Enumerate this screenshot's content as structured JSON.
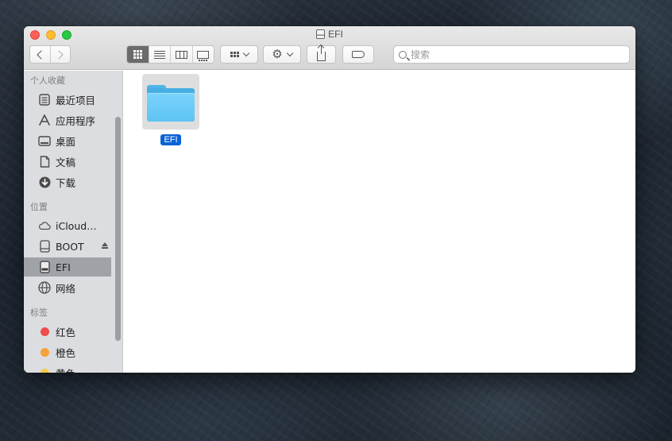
{
  "window": {
    "title": "EFI",
    "title_icon": "drive-icon"
  },
  "toolbar": {
    "back_icon": "chevron-left-icon",
    "forward_icon": "chevron-right-icon",
    "views": [
      "icon-view",
      "list-view",
      "column-view",
      "gallery-view"
    ],
    "active_view": "icon-view",
    "search": {
      "placeholder": "搜索",
      "value": ""
    }
  },
  "sidebar": {
    "sections": [
      {
        "title": "个人收藏",
        "items": [
          {
            "label": "最近项目",
            "icon": "recents-icon"
          },
          {
            "label": "应用程序",
            "icon": "applications-icon"
          },
          {
            "label": "桌面",
            "icon": "desktop-icon"
          },
          {
            "label": "文稿",
            "icon": "documents-icon"
          },
          {
            "label": "下载",
            "icon": "downloads-icon"
          }
        ]
      },
      {
        "title": "位置",
        "items": [
          {
            "label": "iCloud…",
            "icon": "cloud-icon"
          },
          {
            "label": "BOOT",
            "icon": "drive-icon",
            "ejectable": true
          },
          {
            "label": "EFI",
            "icon": "drive-icon",
            "selected": true
          },
          {
            "label": "网络",
            "icon": "network-icon"
          }
        ]
      },
      {
        "title": "标签",
        "items": [
          {
            "label": "红色",
            "color": "#ef4c4c"
          },
          {
            "label": "橙色",
            "color": "#f6a23a"
          },
          {
            "label": "黄色",
            "color": "#f5c94a"
          }
        ]
      }
    ]
  },
  "content": {
    "items": [
      {
        "name": "EFI",
        "type": "folder",
        "selected": true,
        "color": "#5ec3f4"
      }
    ]
  }
}
